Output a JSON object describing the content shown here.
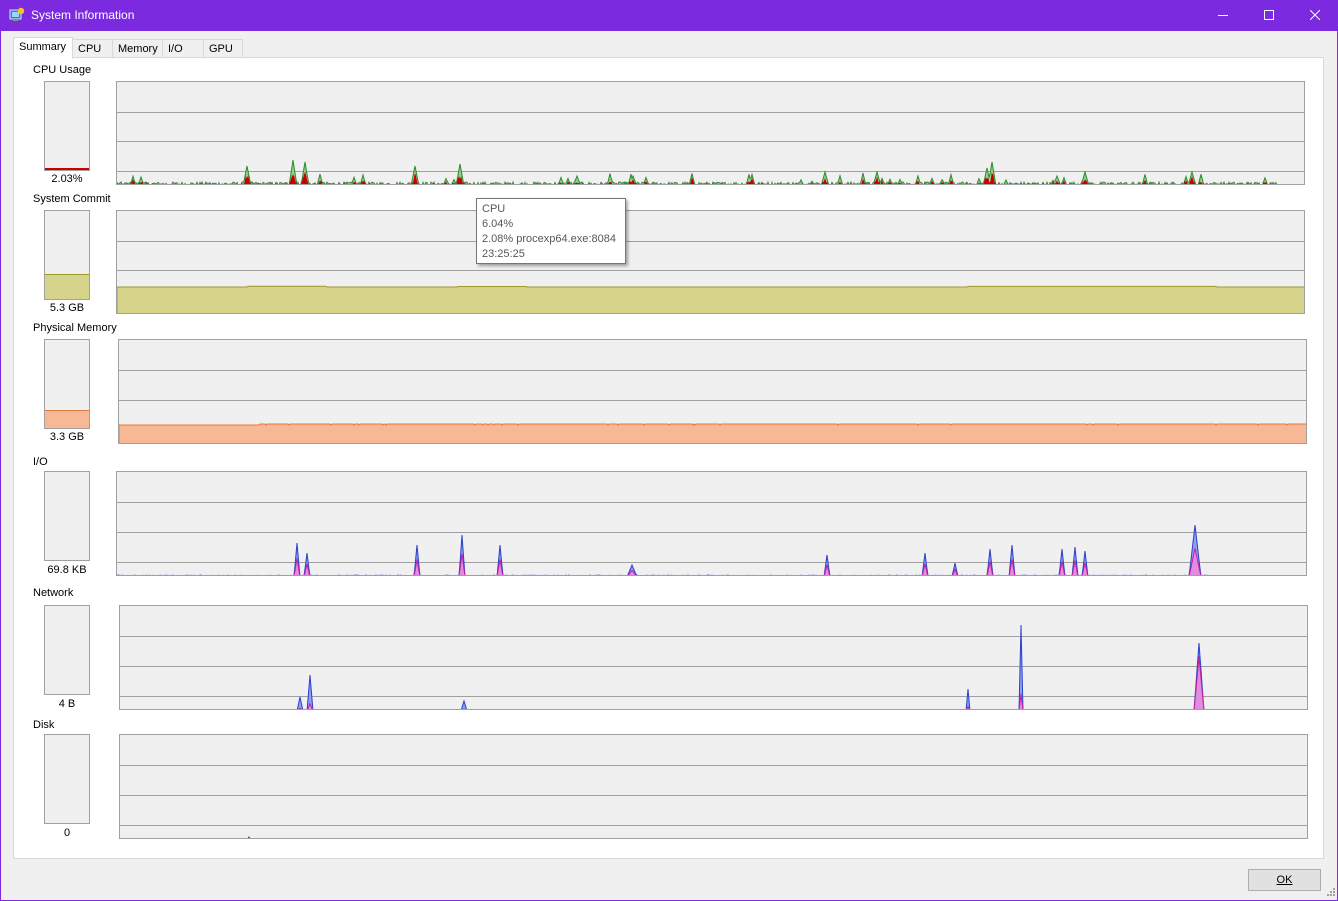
{
  "window": {
    "title": "System Information",
    "accent_color": "#7b2ae0",
    "icon": "system-info-icon"
  },
  "tabs": [
    {
      "label": "Summary",
      "active": true
    },
    {
      "label": "CPU",
      "active": false
    },
    {
      "label": "Memory",
      "active": false
    },
    {
      "label": "I/O",
      "active": false
    },
    {
      "label": "GPU",
      "active": false
    }
  ],
  "panels": {
    "cpu": {
      "label": "CPU Usage",
      "value": "2.03%",
      "level": 0.02,
      "color": "#cc0000"
    },
    "commit": {
      "label": "System Commit",
      "value": "5.3 GB",
      "level": 0.28,
      "color": "#d6d48a",
      "line_color": "#9a9a2a"
    },
    "physical": {
      "label": "Physical Memory",
      "value": "3.3 GB",
      "level": 0.21,
      "color": "#f7b896",
      "line_color": "#e07a3a"
    },
    "io": {
      "label": "I/O",
      "value": "69.8  KB"
    },
    "network": {
      "label": "Network",
      "value": "4 B"
    },
    "disk": {
      "label": "Disk",
      "value": "0"
    }
  },
  "tooltip": {
    "title": "CPU",
    "total": "6.04%",
    "process": "2.08% procexp64.exe:8084",
    "time": "23:25:25"
  },
  "buttons": {
    "ok": "OK"
  },
  "series_colors": {
    "cpu_total": "#2e8b2e",
    "cpu_total_fill": "#8fcf8f",
    "cpu_kernel": "#cc0000",
    "io_read": "#2a3fd0",
    "io_read_fill": "#8ea0ee",
    "io_write": "#c020a0",
    "io_write_fill": "#e28ce0"
  }
}
